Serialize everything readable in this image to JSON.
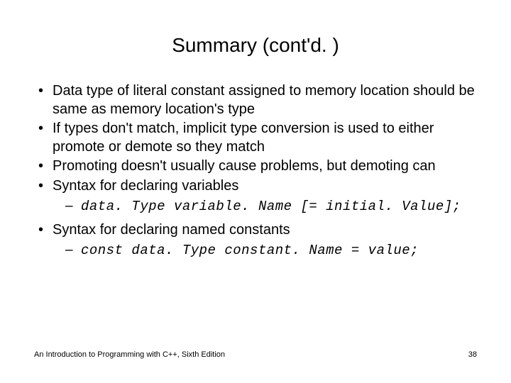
{
  "title": "Summary (cont'd. )",
  "bullets": {
    "b1": "Data type of literal constant assigned to memory location should be same as memory location's type",
    "b2": "If types don't match, implicit type conversion is used to either promote or demote so they match",
    "b3": "Promoting doesn't usually cause problems, but demoting can",
    "b4": "Syntax for declaring variables",
    "b4_sub": "data. Type variable. Name [= initial. Value];",
    "b5": "Syntax for declaring named constants",
    "b5_sub": "const data. Type constant. Name = value;"
  },
  "footer": {
    "left": "An Introduction to Programming with C++, Sixth Edition",
    "right": "38"
  }
}
